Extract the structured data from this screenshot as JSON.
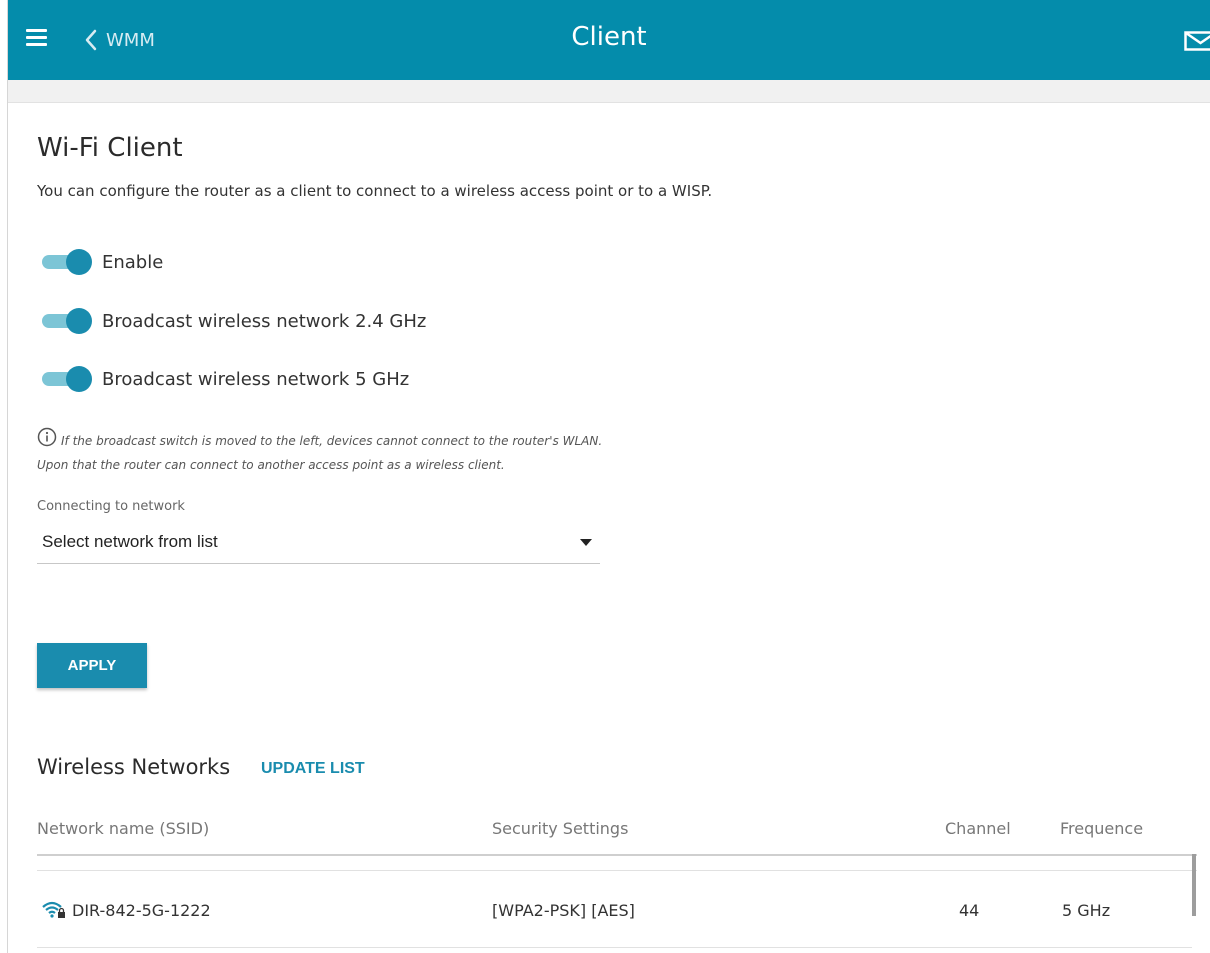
{
  "header": {
    "back_label": "WMM",
    "title": "Client",
    "bg_color": "#048cab"
  },
  "main": {
    "section_title": "Wi-Fi Client",
    "description": "You can configure the router as a client to connect to a wireless access point or to a WISP.",
    "toggles": [
      {
        "label": "Enable",
        "on": true
      },
      {
        "label": "Broadcast wireless network 2.4 GHz",
        "on": true
      },
      {
        "label": "Broadcast wireless network 5 GHz",
        "on": true
      }
    ],
    "info_text": "If the broadcast switch is moved to the left, devices cannot connect to the router's WLAN. Upon that the router can connect to another access point as a wireless client.",
    "network_field": {
      "label": "Connecting to network",
      "value": "Select network from list"
    },
    "apply_label": "APPLY",
    "accent_color": "#1a8cae"
  },
  "networks": {
    "title": "Wireless Networks",
    "update_label": "UPDATE LIST",
    "columns": [
      "Network name (SSID)",
      "Security Settings",
      "Channel",
      "Frequence"
    ],
    "rows": [
      {
        "ssid": "DIR-842-5G-1222",
        "security": "[WPA2-PSK] [AES]",
        "channel": "44",
        "frequency": "5 GHz"
      }
    ]
  }
}
